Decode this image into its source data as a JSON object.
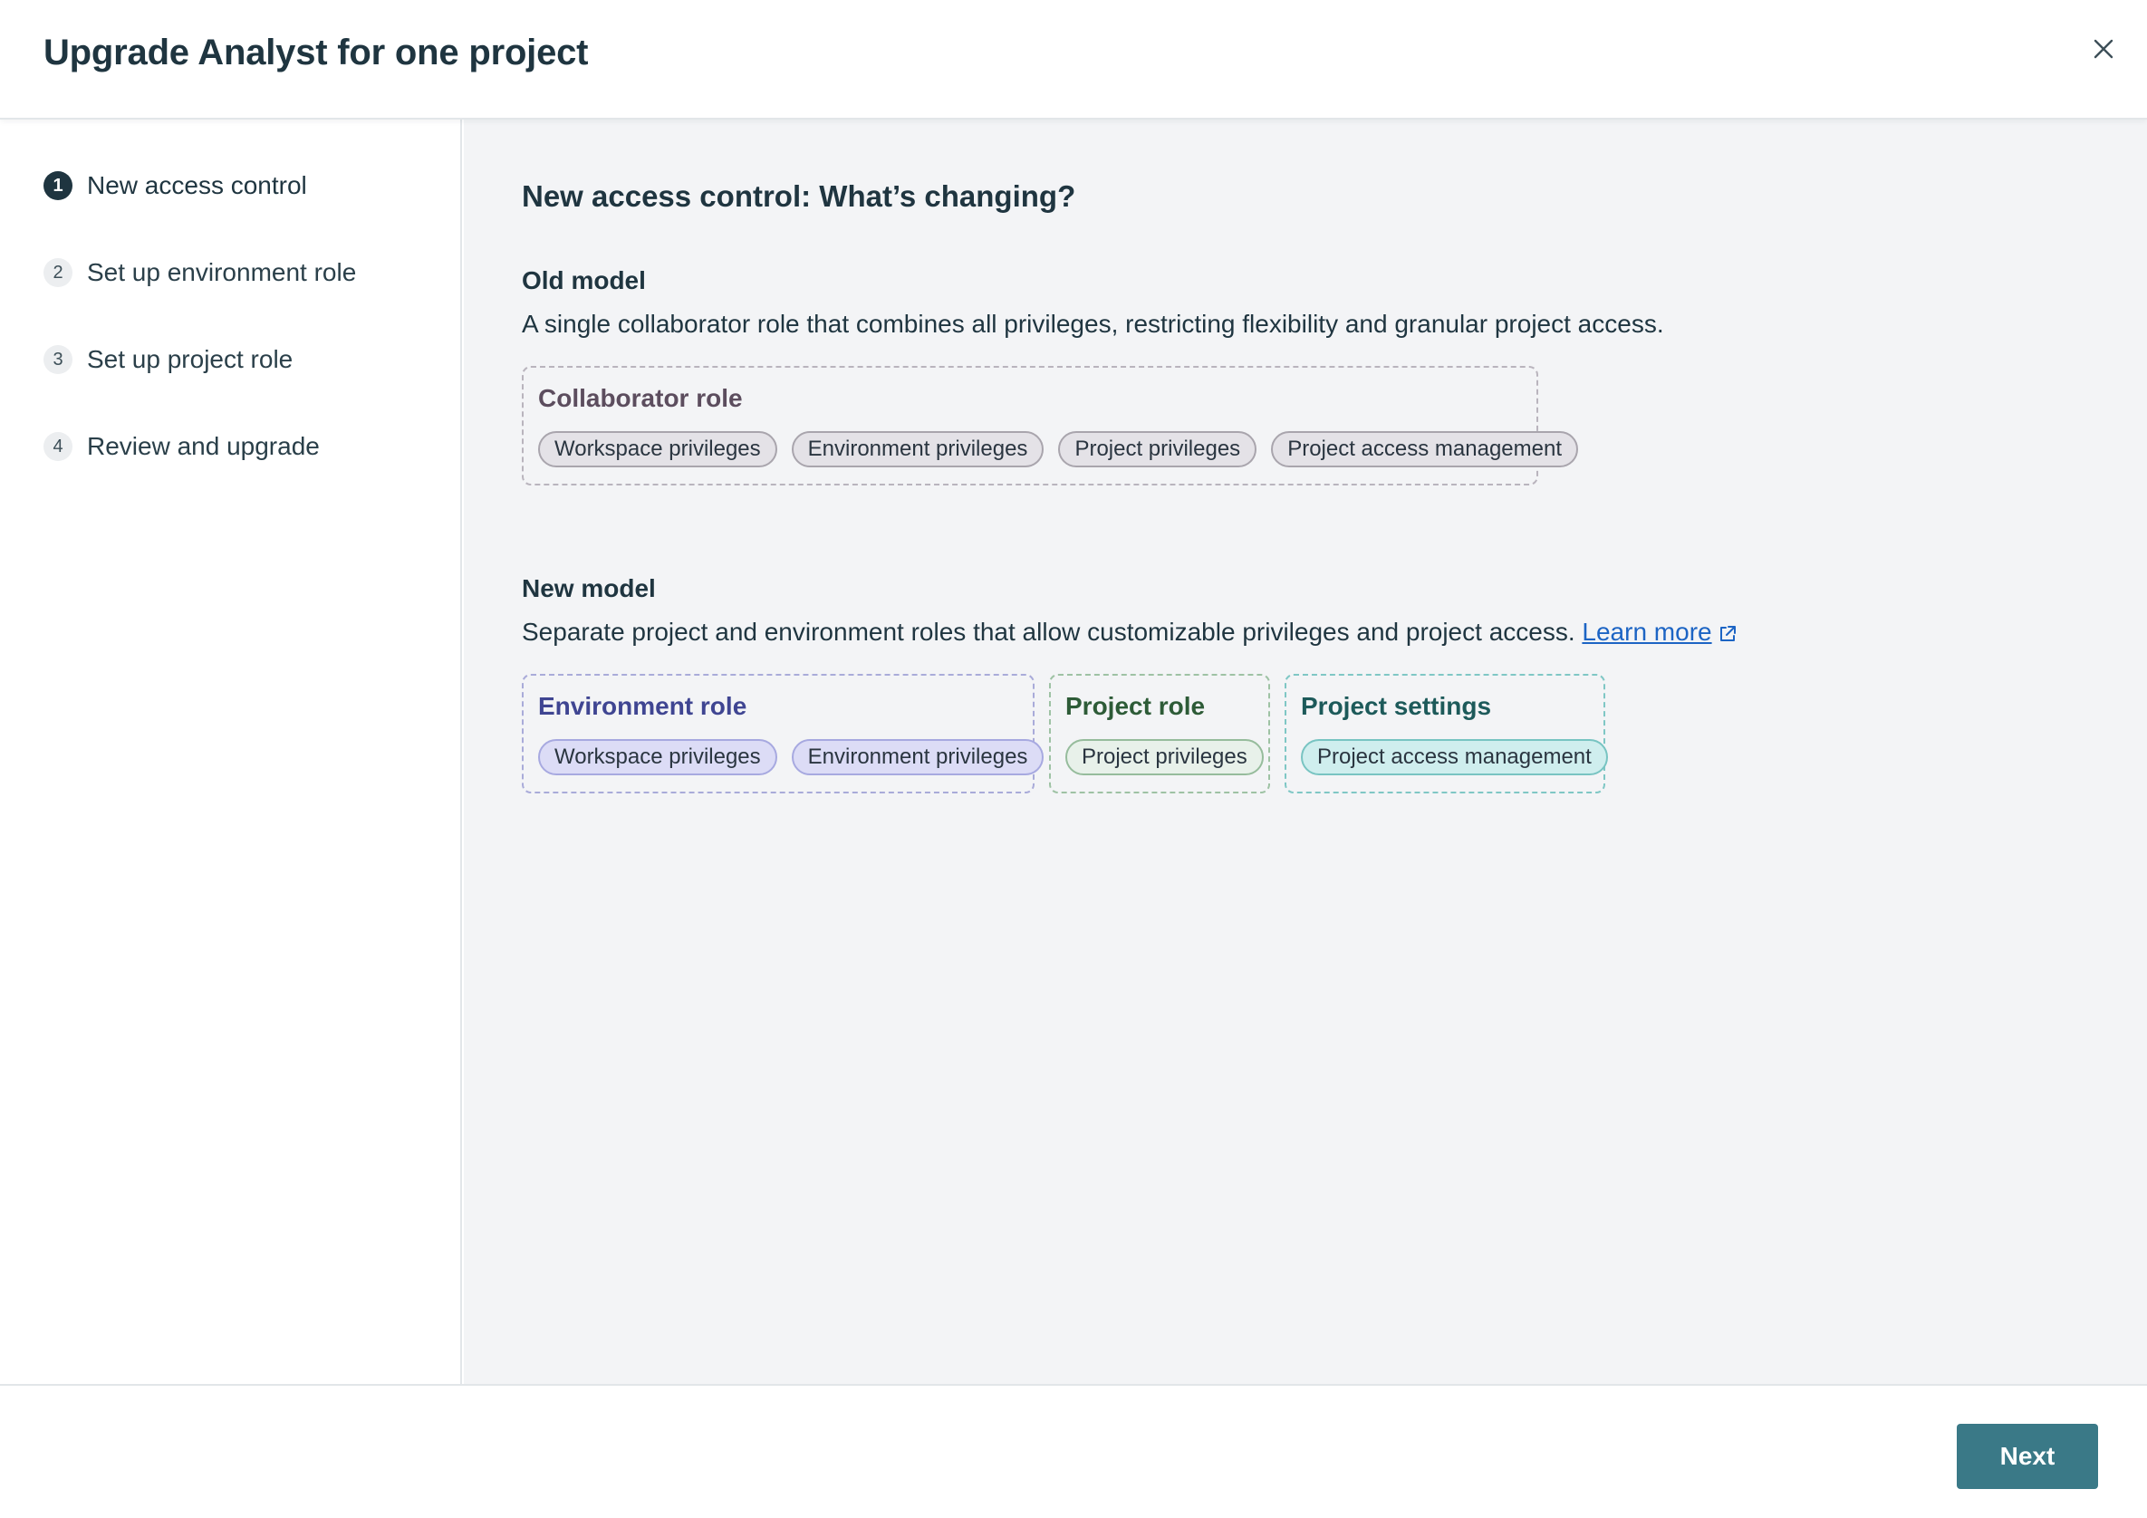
{
  "dialog": {
    "title": "Upgrade Analyst for one project",
    "close_icon": "close-icon"
  },
  "steps": [
    {
      "number": "1",
      "label": "New access control",
      "active": true
    },
    {
      "number": "2",
      "label": "Set up environment role",
      "active": false
    },
    {
      "number": "3",
      "label": "Set up project role",
      "active": false
    },
    {
      "number": "4",
      "label": "Review and upgrade",
      "active": false
    }
  ],
  "main": {
    "title": "New access control: What’s changing?",
    "old_model": {
      "heading": "Old model",
      "description": "A single collaborator role that combines all privileges, restricting flexibility and granular project access.",
      "role": {
        "title": "Collaborator role",
        "chips": [
          "Workspace privileges",
          "Environment privileges",
          "Project privileges",
          "Project access management"
        ]
      }
    },
    "new_model": {
      "heading": "New model",
      "description": "Separate project and environment roles that allow customizable privileges and project access.",
      "learn_more": "Learn more",
      "learn_more_icon": "external-link-icon",
      "roles": [
        {
          "title": "Environment role",
          "chips": [
            "Workspace privileges",
            "Environment privileges"
          ]
        },
        {
          "title": "Project role",
          "chips": [
            "Project privileges"
          ]
        },
        {
          "title": "Project settings",
          "chips": [
            "Project access management"
          ]
        }
      ]
    }
  },
  "footer": {
    "next_label": "Next"
  },
  "colors": {
    "primary_button": "#3a7987",
    "link": "#1c64c4",
    "collaborator": "#e4e2e7",
    "environment": "#dcdcf6",
    "project": "#e8f1ea",
    "settings": "#cfeeee"
  }
}
